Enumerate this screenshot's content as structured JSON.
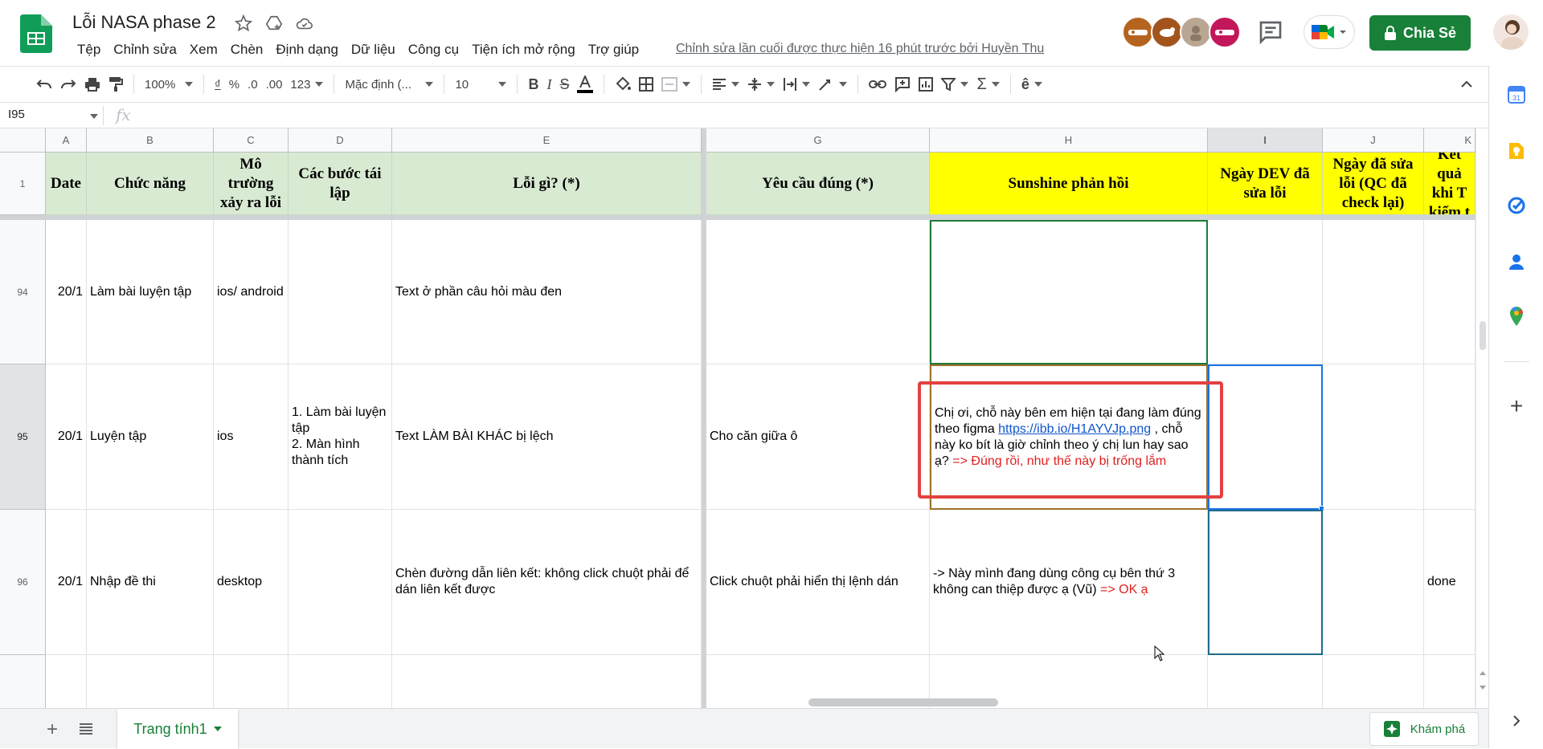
{
  "app": {
    "title": "Lỗi NASA phase 2",
    "menu": [
      "Tệp",
      "Chỉnh sửa",
      "Xem",
      "Chèn",
      "Định dạng",
      "Dữ liệu",
      "Công cụ",
      "Tiện ích mở rộng",
      "Trợ giúp"
    ],
    "last_edit": "Chỉnh sửa lần cuối được thực hiện 16 phút trước bởi Huyền Thu",
    "share_label": "Chia Sẻ"
  },
  "toolbar": {
    "zoom": "100%",
    "currency": "₫",
    "percent": "%",
    "dec_decrease": ".0",
    "dec_increase": ".00",
    "format_more": "123",
    "font": "Mặc định (...",
    "font_size": "10"
  },
  "formula_bar": {
    "cell_ref": "I95",
    "fx": "fx",
    "value": ""
  },
  "grid": {
    "columns": [
      "A",
      "B",
      "C",
      "D",
      "E",
      "G",
      "H",
      "I",
      "J",
      "K"
    ],
    "header_row": {
      "row_num": "1",
      "A": "Date",
      "B": "Chức năng",
      "C": "Mô trường xảy ra lỗi",
      "D": "Các bước tái lập",
      "E": "Lỗi gì? (*)",
      "G": "Yêu cầu đúng (*)",
      "H": "Sunshine phản hồi",
      "I": "Ngày DEV đã sửa lỗi",
      "J": "Ngày đã sửa lỗi  (QC đã check lại)",
      "K": "Kết quả khi T kiểm t"
    },
    "rows": [
      {
        "row_num": "94",
        "A": "20/1",
        "B": "Làm bài luyện tập",
        "C": "ios/ android",
        "D": "",
        "E": "Text ở phần câu hỏi màu đen",
        "G": "",
        "H": "",
        "K": ""
      },
      {
        "row_num": "95",
        "A": "20/1",
        "B": "Luyện tập",
        "C": "ios",
        "D": "1. Làm bài luyện tập\n2. Màn hình thành tích",
        "E": "Text LÀM BÀI KHÁC bị lệch",
        "G": "Cho căn giữa ô",
        "H_part1": "Chị ơi, chỗ này bên em hiện tại đang làm đúng theo figma ",
        "H_link": "https://ibb.io/H1AYVJp.png",
        "H_part2": " , chỗ này ko bít là giờ chỉnh theo ý chị lun hay sao ạ? ",
        "H_red": "=> Đúng rồi, như thế này bị trống lắm",
        "K": ""
      },
      {
        "row_num": "96",
        "A": "20/1",
        "B": "Nhập đề thi",
        "C": "desktop",
        "D": "",
        "E": "Chèn đường dẫn liên kết: không click chuột phải để dán liên kết được",
        "G": "Click chuột phải hiển thị lệnh dán",
        "H_part1": "-> Này mình đang dùng công cụ bên thứ 3 không can thiệp được ạ (Vũ) ",
        "H_red": "=> OK ạ",
        "K": "done"
      }
    ]
  },
  "bottom": {
    "sheet_tab": "Trang tính1",
    "explore": "Khám phá"
  },
  "colors": {
    "accent": "#188038",
    "header_green": "#d9ead3",
    "header_yellow": "#ffff00",
    "selection_blue": "#1a73e8",
    "highlight_red": "#e34141"
  }
}
